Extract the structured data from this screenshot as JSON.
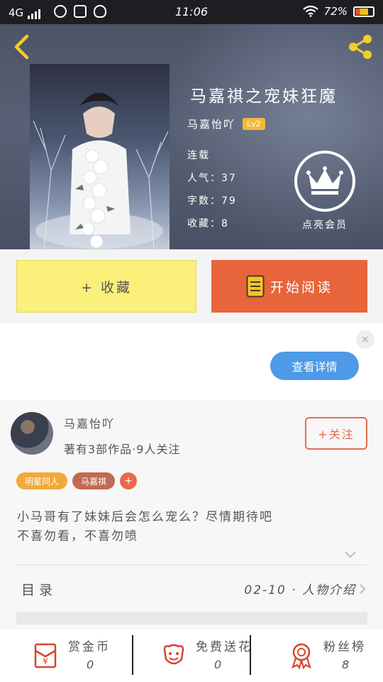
{
  "status_bar": {
    "network": "4G",
    "time": "11:06",
    "battery": "72%"
  },
  "book": {
    "title": "马嘉祺之宠妹狂魔",
    "author": "马嘉怡吖",
    "author_level": "Lv2",
    "status": "连载",
    "popularity": "人气：37",
    "word_count": "字数：79",
    "favorites": "收藏：8",
    "vip_label": "点亮会员"
  },
  "actions": {
    "collect": "+ 收藏",
    "read": "开始阅读"
  },
  "ad": {
    "details_button": "查看详情",
    "close": "×"
  },
  "author": {
    "name": "马嘉怡吖",
    "summary": "著有3部作品·9人关注",
    "follow_button": "+关注"
  },
  "tags": [
    {
      "label": "明星同人",
      "color": "#f2a93b"
    },
    {
      "label": "马嘉祺",
      "color": "#c26a52"
    }
  ],
  "tag_add": "+",
  "description": "小马哥有了妹妹后会怎么宠么？尽情期待吧\n不喜勿看，不喜勿喷",
  "toc": {
    "label": "目录",
    "latest": "02-10 · 人物介绍"
  },
  "stats": [
    {
      "label": "赏金币",
      "value": "0",
      "icon": "red-envelope-icon"
    },
    {
      "label": "免费送花",
      "value": "0",
      "icon": "flower-icon"
    },
    {
      "label": "粉丝榜",
      "value": "8",
      "icon": "medal-icon"
    }
  ],
  "colors": {
    "accent_orange": "#e8643a",
    "collect_yellow": "#fbf07a",
    "blue_button": "#4e9ae8",
    "icon_red": "#d9432e"
  }
}
